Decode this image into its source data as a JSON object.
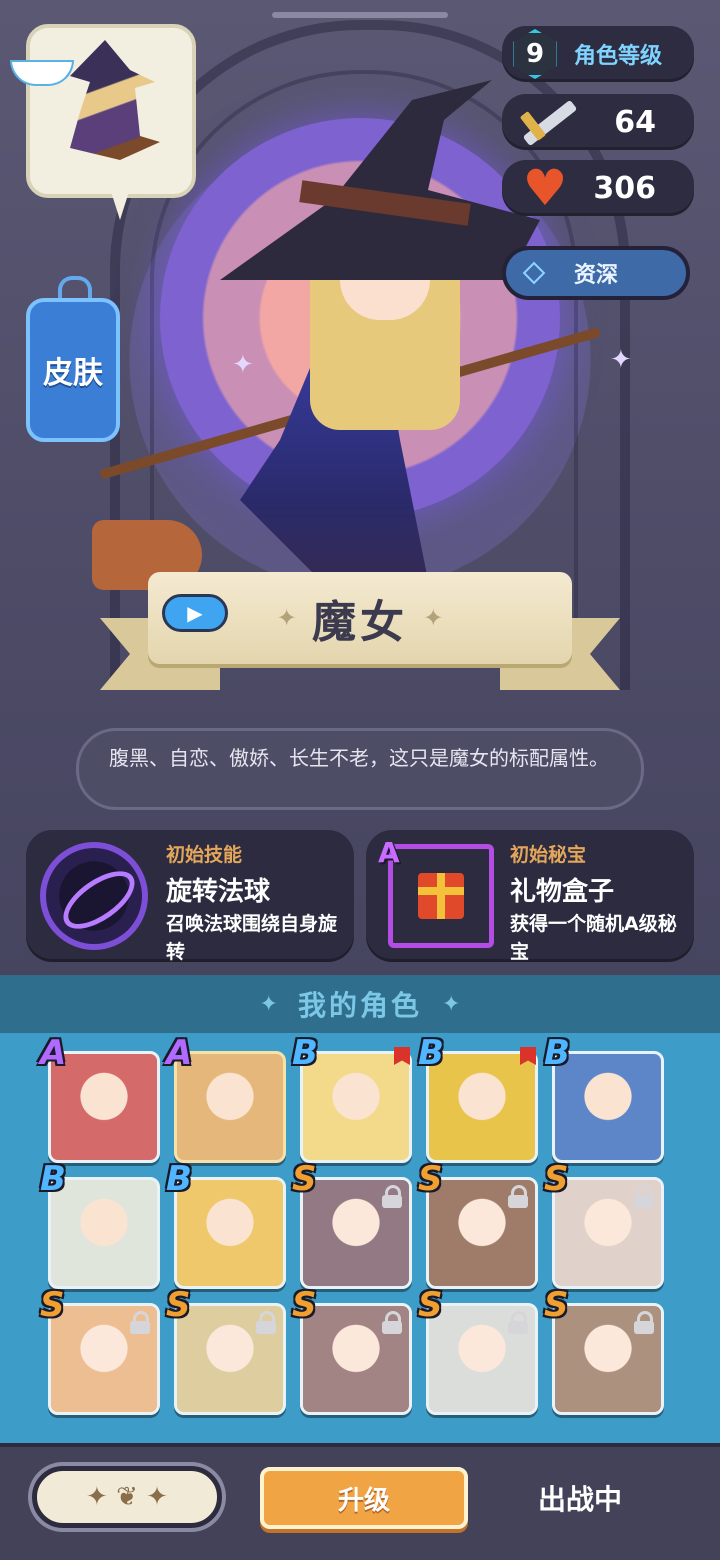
{
  "character": {
    "level": "9",
    "level_label": "角色等级",
    "attack": "64",
    "hp": "306",
    "rank_label": "资深",
    "skin_label": "皮肤",
    "name": "魔女",
    "description": "腹黑、自恋、傲娇、长生不老，这只是魔女的标配属性。"
  },
  "skill": {
    "kicker": "初始技能",
    "title": "旋转法球",
    "desc": "召唤法球围绕自身旋转"
  },
  "treasure": {
    "kicker": "初始秘宝",
    "rank": "A",
    "title": "礼物盒子",
    "desc": "获得一个随机A级秘宝"
  },
  "roster": {
    "title": "我的角色",
    "tiles": [
      {
        "rank": "A",
        "rank_color": "#b06aff",
        "bg": "#d46a6a",
        "locked": false,
        "new": false,
        "icon": "armored-monster-portrait"
      },
      {
        "rank": "A",
        "rank_color": "#b06aff",
        "bg": "#e6b77a",
        "locked": false,
        "new": false,
        "icon": "witch-portrait",
        "selected": true
      },
      {
        "rank": "B",
        "rank_color": "#4fb6ff",
        "bg": "#f3d98a",
        "locked": false,
        "new": true,
        "icon": "blonde-girl-portrait"
      },
      {
        "rank": "B",
        "rank_color": "#4fb6ff",
        "bg": "#e9c44a",
        "locked": false,
        "new": true,
        "icon": "yellow-bird-portrait"
      },
      {
        "rank": "B",
        "rank_color": "#4fb6ff",
        "bg": "#5d86c8",
        "locked": false,
        "new": false,
        "icon": "blue-hair-boy-portrait"
      },
      {
        "rank": "B",
        "rank_color": "#4fb6ff",
        "bg": "#dfe5da",
        "locked": false,
        "new": false,
        "icon": "cat-ear-girl-portrait"
      },
      {
        "rank": "B",
        "rank_color": "#4fb6ff",
        "bg": "#eec86a",
        "locked": false,
        "new": false,
        "icon": "blonde-boy-portrait"
      },
      {
        "rank": "S",
        "rank_color": "#f0a030",
        "bg": "#7b5c6a",
        "locked": true,
        "new": false,
        "icon": "dark-hair-girl-portrait"
      },
      {
        "rank": "S",
        "rank_color": "#f0a030",
        "bg": "#8a6048",
        "locked": true,
        "new": false,
        "icon": "dark-skin-man-portrait"
      },
      {
        "rank": "S",
        "rank_color": "#f0a030",
        "bg": "#d9c7c0",
        "locked": true,
        "new": false,
        "icon": "white-hair-girl-portrait"
      },
      {
        "rank": "S",
        "rank_color": "#f0a030",
        "bg": "#e8b07a",
        "locked": true,
        "new": false,
        "icon": "orange-hair-girl-portrait"
      },
      {
        "rank": "S",
        "rank_color": "#f0a030",
        "bg": "#d7c48a",
        "locked": true,
        "new": false,
        "icon": "blonde-woman-portrait"
      },
      {
        "rank": "S",
        "rank_color": "#f0a030",
        "bg": "#8e6a6a",
        "locked": true,
        "new": false,
        "icon": "black-hair-girl-portrait"
      },
      {
        "rank": "S",
        "rank_color": "#f0a030",
        "bg": "#d3d6d2",
        "locked": true,
        "new": false,
        "icon": "silver-hair-girl-portrait"
      },
      {
        "rank": "S",
        "rank_color": "#f0a030",
        "bg": "#9a7a62",
        "locked": true,
        "new": false,
        "icon": "brunette-girl-portrait"
      }
    ]
  },
  "bottom": {
    "upgrade_label": "升级",
    "status_label": "出战中"
  }
}
